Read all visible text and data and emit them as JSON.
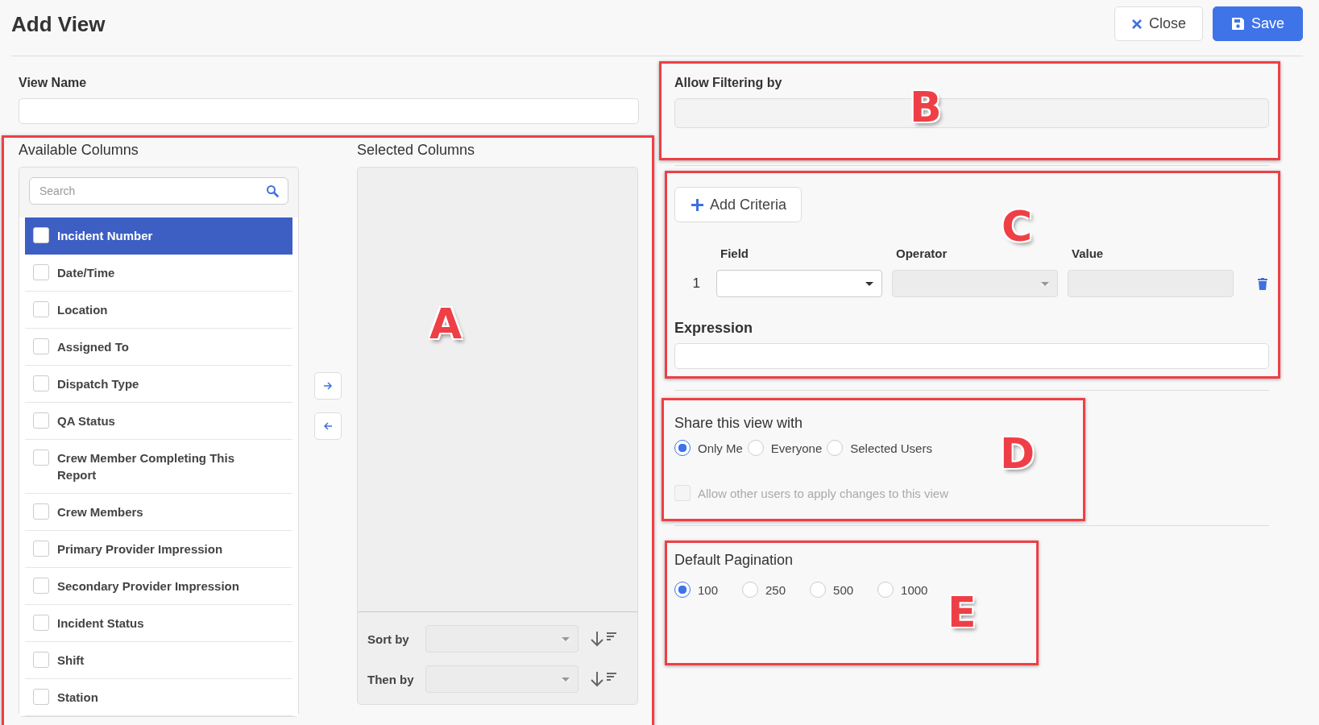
{
  "title": "Add View",
  "header_buttons": [
    {
      "kind": "close",
      "label": "Close"
    },
    {
      "kind": "save",
      "label": "Save"
    }
  ],
  "view_name": {
    "label": "View Name"
  },
  "columns_section": {
    "annotation": "A",
    "available": {
      "title": "Available Columns",
      "search": {
        "placeholder": "Search"
      },
      "items": [
        {
          "label": "Incident Number",
          "selected": true,
          "checked": false
        },
        {
          "label": "Date/Time",
          "selected": false,
          "checked": false
        },
        {
          "label": "Location",
          "selected": false,
          "checked": false
        },
        {
          "label": "Assigned To",
          "selected": false,
          "checked": false
        },
        {
          "label": "Dispatch Type",
          "selected": false,
          "checked": false
        },
        {
          "label": "QA Status",
          "selected": false,
          "checked": false
        },
        {
          "label": "Crew Member Completing This Report",
          "selected": false,
          "checked": false
        },
        {
          "label": "Crew Members",
          "selected": false,
          "checked": false
        },
        {
          "label": "Primary Provider Impression",
          "selected": false,
          "checked": false
        },
        {
          "label": "Secondary Provider Impression",
          "selected": false,
          "checked": false
        },
        {
          "label": "Incident Status",
          "selected": false,
          "checked": false
        },
        {
          "label": "Shift",
          "selected": false,
          "checked": false
        },
        {
          "label": "Station",
          "selected": false,
          "checked": false
        }
      ]
    },
    "selected": {
      "title": "Selected Columns",
      "sort": [
        {
          "label": "Sort by"
        },
        {
          "label": "Then by"
        }
      ]
    }
  },
  "filtering": {
    "annotation": "B",
    "label": "Allow Filtering by"
  },
  "criteria": {
    "annotation": "C",
    "add_button": "Add Criteria",
    "headers": [
      "Field",
      "Operator",
      "Value"
    ],
    "rows": [
      {
        "number": "1",
        "fields": [
          {
            "kind": "dropdown",
            "disabled": false
          },
          {
            "kind": "dropdown",
            "disabled": true
          },
          {
            "kind": "text",
            "disabled": true
          }
        ]
      }
    ],
    "expression": {
      "label": "Expression"
    }
  },
  "share": {
    "annotation": "D",
    "title": "Share this view with",
    "options": [
      {
        "label": "Only Me",
        "selected": true
      },
      {
        "label": "Everyone",
        "selected": false
      },
      {
        "label": "Selected Users",
        "selected": false
      }
    ],
    "allow_changes": {
      "label": "Allow other users to apply changes to this view",
      "checked": false,
      "disabled": true
    }
  },
  "pagination": {
    "annotation": "E",
    "title": "Default Pagination",
    "options": [
      {
        "label": "100",
        "selected": true
      },
      {
        "label": "250",
        "selected": false
      },
      {
        "label": "500",
        "selected": false
      },
      {
        "label": "1000",
        "selected": false
      }
    ]
  }
}
